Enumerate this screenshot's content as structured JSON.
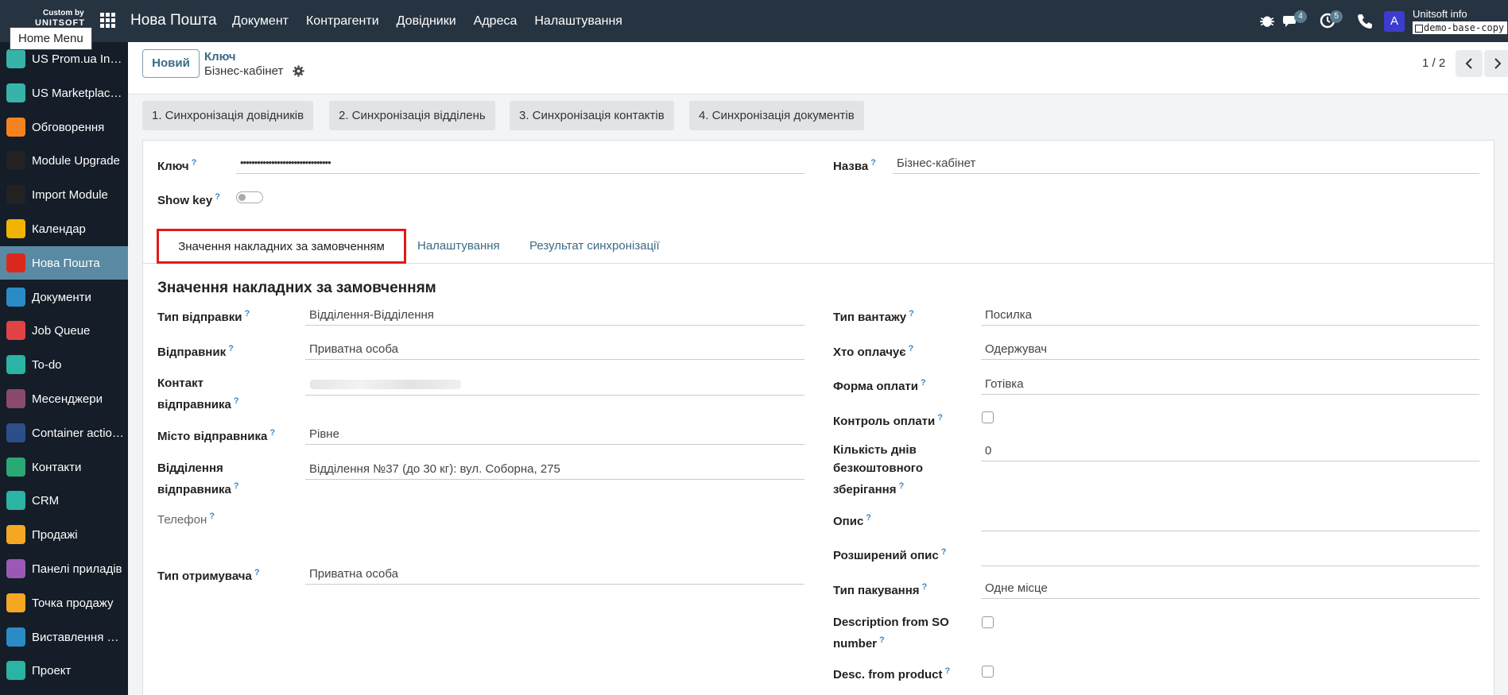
{
  "topbar": {
    "logo_small": "Custom by",
    "logo_big": "UNITSOFT",
    "app_name": "Нова Пошта",
    "menu": [
      "Документ",
      "Контрагенти",
      "Довідники",
      "Адреса",
      "Налаштування"
    ],
    "tooltip": "Home Menu",
    "chat_count": "4",
    "activity_count": "5",
    "avatar_letter": "A",
    "user_name": "Unitsoft info",
    "db_name": "demo-base-copy"
  },
  "sidebar": {
    "items": [
      {
        "label": "US Prom.ua Inte...",
        "icon": "cube-icon",
        "color": "#37b3a8"
      },
      {
        "label": "US Marketplace...",
        "icon": "cube-icon",
        "color": "#37b3a8"
      },
      {
        "label": "Обговорення",
        "icon": "discuss-icon",
        "color": "#f58220"
      },
      {
        "label": "Module Upgrade",
        "icon": "upgrade-icon",
        "color": "#222222"
      },
      {
        "label": "Import Module",
        "icon": "import-icon",
        "color": "#222222"
      },
      {
        "label": "Календар",
        "icon": "calendar-icon",
        "color": "#f0b400"
      },
      {
        "label": "Нова Пошта",
        "icon": "nova-poshta-icon",
        "color": "#da291c"
      },
      {
        "label": "Документи",
        "icon": "documents-icon",
        "color": "#2a8bc7"
      },
      {
        "label": "Job Queue",
        "icon": "job-queue-icon",
        "color": "#e04343"
      },
      {
        "label": "To-do",
        "icon": "todo-icon",
        "color": "#2bb3a3"
      },
      {
        "label": "Месенджери",
        "icon": "messengers-icon",
        "color": "#8a4b6b"
      },
      {
        "label": "Container actions",
        "icon": "container-icon",
        "color": "#2c4f8a"
      },
      {
        "label": "Контакти",
        "icon": "contacts-icon",
        "color": "#2aa876"
      },
      {
        "label": "CRM",
        "icon": "crm-icon",
        "color": "#2bb3a3"
      },
      {
        "label": "Продажі",
        "icon": "sales-icon",
        "color": "#f5a623"
      },
      {
        "label": "Панелі приладів",
        "icon": "dashboard-icon",
        "color": "#9b59b6"
      },
      {
        "label": "Точка продажу",
        "icon": "pos-icon",
        "color": "#f5a623"
      },
      {
        "label": "Виставлення ра...",
        "icon": "invoicing-icon",
        "color": "#2a8bc7"
      },
      {
        "label": "Проект",
        "icon": "project-icon",
        "color": "#2bb3a3"
      }
    ]
  },
  "control": {
    "new_label": "Новий",
    "breadcrumb_parent": "Ключ",
    "breadcrumb_current": "Бізнес-кабінет",
    "pager": "1 / 2"
  },
  "sync_buttons": [
    "1. Синхронізація довідників",
    "2. Синхронізація відділень",
    "3. Синхронізація контактів",
    "4. Синхронізація документів"
  ],
  "header_fields": {
    "key_label": "Ключ",
    "key_value": "••••••••••••••••••••••••••••••••",
    "name_label": "Назва",
    "name_value": "Бізнес-кабінет",
    "show_key_label": "Show key"
  },
  "help_mark": "?",
  "tabs": [
    "Значення накладних за замовченням",
    "Налаштування",
    "Результат синхронізації"
  ],
  "section_title": "Значення накладних за замовченням",
  "left_fields": {
    "send_type_label": "Тип відправки",
    "send_type_value": "Відділення-Відділення",
    "sender_label": "Відправник",
    "sender_value": "Приватна особа",
    "sender_contact_label_1": "Контакт",
    "sender_contact_label_2": "відправника",
    "sender_city_label": "Місто відправника",
    "sender_city_value": "Рівне",
    "sender_branch_label_1": "Відділення",
    "sender_branch_label_2": "відправника",
    "sender_branch_value": "Відділення №37 (до 30 кг): вул. Соборна, 275",
    "phone_label": "Телефон",
    "recipient_type_label": "Тип отримувача",
    "recipient_type_value": "Приватна особа"
  },
  "right_fields": {
    "cargo_type_label": "Тип вантажу",
    "cargo_type_value": "Посилка",
    "payer_label": "Хто оплачує",
    "payer_value": "Одержувач",
    "payment_form_label": "Форма оплати",
    "payment_form_value": "Готівка",
    "payment_control_label": "Контроль оплати",
    "free_storage_label_1": "Кількість днів",
    "free_storage_label_2": "безкоштовного",
    "free_storage_label_3": "зберігання",
    "free_storage_value": "0",
    "description_label": "Опис",
    "ext_description_label": "Розширений опис",
    "packing_type_label": "Тип пакування",
    "packing_type_value": "Одне місце",
    "desc_so_label_1": "Description from SO",
    "desc_so_label_2": "number",
    "desc_product_label": "Desc. from product"
  }
}
